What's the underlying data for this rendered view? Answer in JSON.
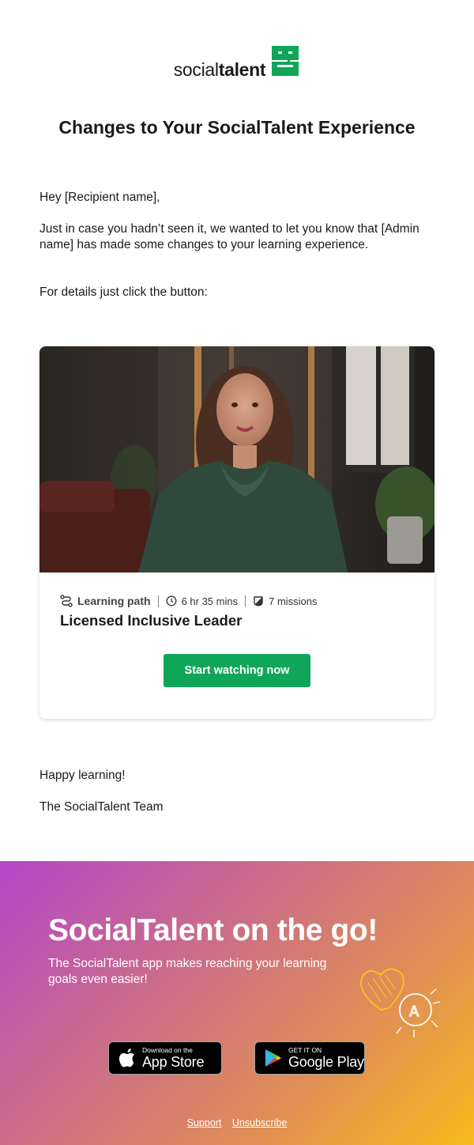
{
  "brand": {
    "logo_light": "social",
    "logo_bold": "talent",
    "color": "#10a65a"
  },
  "email": {
    "title": "Changes to Your SocialTalent Experience",
    "greeting": "Hey [Recipient name],",
    "paragraph1": "Just in case you hadn’t seen it, we wanted to let you know that [Admin name] has made some changes to your learning experience.",
    "paragraph2": "For details just click the button:"
  },
  "card": {
    "type_label": "Learning path",
    "duration": "6 hr 35 mins",
    "missions": "7 missions",
    "title": "Licensed Inclusive Leader",
    "cta_label": "Start watching now",
    "icons": [
      "route-icon",
      "clock-icon",
      "mission-icon"
    ]
  },
  "signoff": {
    "line1": "Happy learning!",
    "line2": "The SocialTalent Team"
  },
  "footer": {
    "title": "SocialTalent on the go!",
    "subtitle": "The SocialTalent app makes reaching your learning goals even easier!",
    "app_store_small": "Download on the",
    "app_store_big": "App Store",
    "google_play_small": "GET IT ON",
    "google_play_big": "Google Play",
    "links": [
      "Support",
      "Unsubscribe"
    ],
    "gradient_colors": [
      "#b447c9",
      "#cc6f86",
      "#e08f55",
      "#f6bb1c"
    ]
  }
}
